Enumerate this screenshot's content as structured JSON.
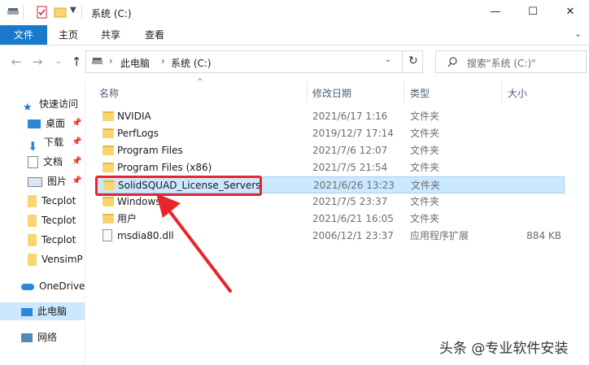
{
  "window": {
    "title": "系统 (C:)",
    "controls": [
      "—",
      "☐",
      "✕"
    ]
  },
  "ribbon": {
    "tabs": [
      {
        "label": "文件",
        "active": true
      },
      {
        "label": "主页"
      },
      {
        "label": "共享"
      },
      {
        "label": "查看"
      }
    ]
  },
  "address": {
    "crumbs": [
      "此电脑",
      "系统 (C:)"
    ],
    "search_placeholder": "搜索\"系统 (C:)\""
  },
  "nav": {
    "quick_access": "快速访问",
    "items": [
      {
        "label": "桌面",
        "pinned": true,
        "icon": "desktop-icon"
      },
      {
        "label": "下载",
        "pinned": true,
        "icon": "download-icon"
      },
      {
        "label": "文档",
        "pinned": true,
        "icon": "document-icon"
      },
      {
        "label": "图片",
        "pinned": true,
        "icon": "picture-icon"
      },
      {
        "label": "Tecplot",
        "icon": "folder-icon"
      },
      {
        "label": "Tecplot",
        "icon": "folder-icon"
      },
      {
        "label": "Tecplot",
        "icon": "folder-icon"
      },
      {
        "label": "VensimP",
        "icon": "folder-icon"
      }
    ],
    "onedrive": "OneDrive",
    "this_pc": "此电脑",
    "network": "网络"
  },
  "columns": {
    "name": "名称",
    "date": "修改日期",
    "type": "类型",
    "size": "大小"
  },
  "files": [
    {
      "name": "NVIDIA",
      "date": "2021/6/17 1:16",
      "type": "文件夹",
      "size": "",
      "kind": "folder"
    },
    {
      "name": "PerfLogs",
      "date": "2019/12/7 17:14",
      "type": "文件夹",
      "size": "",
      "kind": "folder"
    },
    {
      "name": "Program Files",
      "date": "2021/7/6 12:07",
      "type": "文件夹",
      "size": "",
      "kind": "folder"
    },
    {
      "name": "Program Files (x86)",
      "date": "2021/7/5 21:54",
      "type": "文件夹",
      "size": "",
      "kind": "folder"
    },
    {
      "name": "SolidSQUAD_License_Servers",
      "date": "2021/6/26 13:23",
      "type": "文件夹",
      "size": "",
      "kind": "folder",
      "selected": true
    },
    {
      "name": "Windows",
      "date": "2021/7/5 23:37",
      "type": "文件夹",
      "size": "",
      "kind": "folder"
    },
    {
      "name": "用户",
      "date": "2021/6/21 16:05",
      "type": "文件夹",
      "size": "",
      "kind": "folder"
    },
    {
      "name": "msdia80.dll",
      "date": "2006/12/1 23:37",
      "type": "应用程序扩展",
      "size": "884 KB",
      "kind": "file"
    }
  ],
  "watermark": "头条 @专业软件安装",
  "colors": {
    "accent": "#1979ca",
    "selection": "#cce8ff",
    "annotation": "#e8262a"
  }
}
